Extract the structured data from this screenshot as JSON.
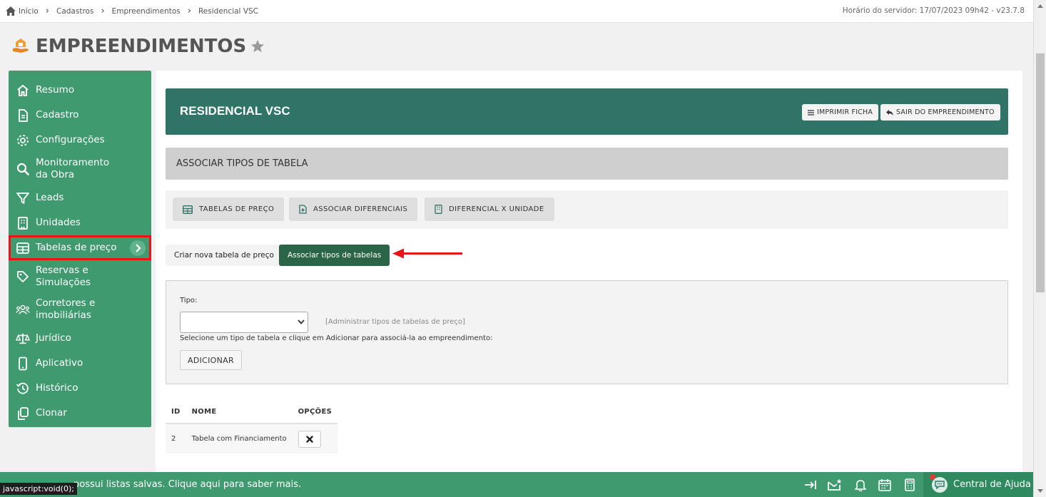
{
  "breadcrumb": {
    "items": [
      "Início",
      "Cadastros",
      "Empreendimentos",
      "Residencial VSC"
    ]
  },
  "server_time": "Horário do servidor: 17/07/2023 09h42 - v23.7.8",
  "page": {
    "title": "EMPREENDIMENTOS"
  },
  "sidebar": {
    "items": [
      {
        "label": "Resumo",
        "icon": "home-icon"
      },
      {
        "label": "Cadastro",
        "icon": "document-icon"
      },
      {
        "label": "Configurações",
        "icon": "gear-icon"
      },
      {
        "label": "Monitoramento da Obra",
        "icon": "search-icon"
      },
      {
        "label": "Leads",
        "icon": "filter-icon"
      },
      {
        "label": "Unidades",
        "icon": "building-icon"
      },
      {
        "label": "Tabelas de preço",
        "icon": "table-icon",
        "active": true
      },
      {
        "label": "Reservas e Simulações",
        "icon": "tag-icon"
      },
      {
        "label": "Corretores e imobiliárias",
        "icon": "users-icon"
      },
      {
        "label": "Jurídico",
        "icon": "scale-icon"
      },
      {
        "label": "Aplicativo",
        "icon": "phone-icon"
      },
      {
        "label": "Histórico",
        "icon": "history-icon"
      },
      {
        "label": "Clonar",
        "icon": "clone-icon"
      }
    ]
  },
  "header": {
    "title": "RESIDENCIAL VSC",
    "print_label": "IMPRIMIR FICHA",
    "exit_label": "SAIR DO EMPREENDIMENTO"
  },
  "section": {
    "title": "ASSOCIAR TIPOS DE TABELA"
  },
  "tabs": [
    {
      "label": "TABELAS DE PREÇO",
      "icon": "table-icon"
    },
    {
      "label": "ASSOCIAR DIFERENCIAIS",
      "icon": "document-plus-icon"
    },
    {
      "label": "DIFERENCIAL X UNIDADE",
      "icon": "building-icon"
    }
  ],
  "subtabs": [
    {
      "label": "Criar nova tabela de preço",
      "active": false
    },
    {
      "label": "Associar tipos de tabelas",
      "active": true
    }
  ],
  "form": {
    "tipo_label": "Tipo:",
    "tipo_value": "",
    "admin_link": "[Administrar tipos de tabelas de preço]",
    "hint": "Selecione um tipo de tabela e clique em Adicionar para associá-la ao empreendimento:",
    "add_label": "ADICIONAR"
  },
  "table": {
    "headers": [
      "ID",
      "NOME",
      "OPÇÕES"
    ],
    "rows": [
      {
        "id": "2",
        "nome": "Tabela com Financiamento"
      }
    ]
  },
  "footer": {
    "message": "possui listas salvas. Clique aqui para saber mais.",
    "js_tooltip": "javascript:void(0);",
    "help_label": "Central de Ajuda"
  },
  "colors": {
    "sidebar": "#3f9a70",
    "header_card": "#2f7467",
    "active_subtab": "#2b6547",
    "highlight": "#e8141a"
  }
}
